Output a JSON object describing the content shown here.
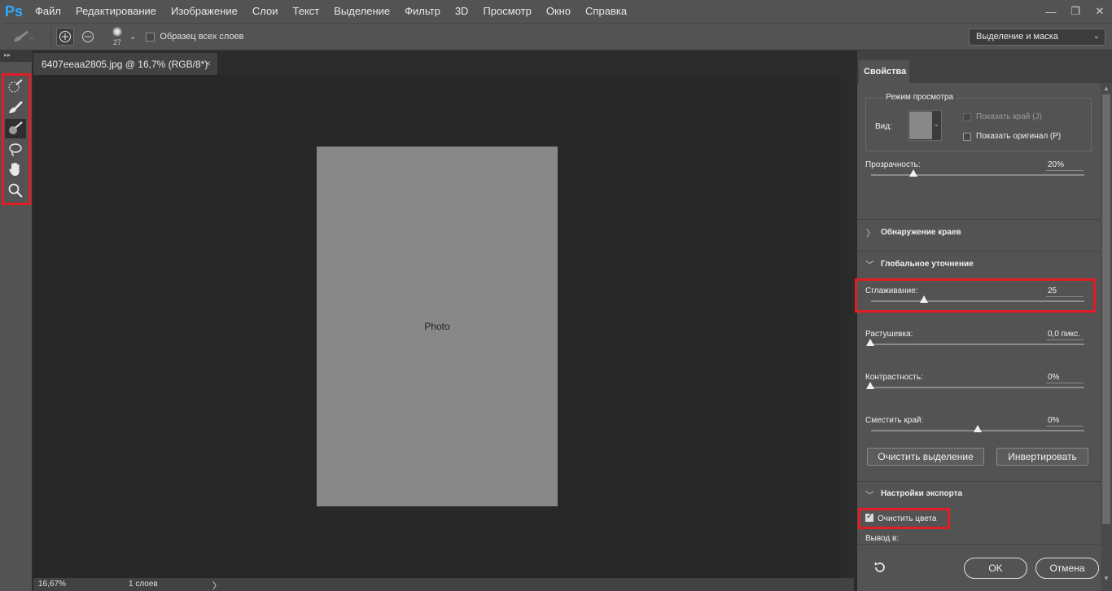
{
  "app": {
    "logo": "Ps"
  },
  "menu": {
    "items": [
      "Файл",
      "Редактирование",
      "Изображение",
      "Слои",
      "Текст",
      "Выделение",
      "Фильтр",
      "3D",
      "Просмотр",
      "Окно",
      "Справка"
    ]
  },
  "window_controls": {
    "minimize": "—",
    "restore": "❐",
    "close": "✕"
  },
  "options": {
    "brush_size": "27",
    "sample_all_layers": "Образец всех слоев",
    "select_and_mask": "Выделение и маска"
  },
  "document": {
    "tab_title": "6407eeaa2805.jpg @ 16,7% (RGB/8*)",
    "close": "×"
  },
  "status": {
    "zoom": "16,67%",
    "layers": "1 слоев",
    "chevron": "〉"
  },
  "properties": {
    "tab": "Свойства",
    "view_mode": {
      "legend": "Режим просмотра",
      "view_label": "Вид:",
      "show_edge": "Показать край (J)",
      "show_original": "Показать оригинал (P)"
    },
    "opacity": {
      "label": "Прозрачность:",
      "value": "20%",
      "level_percent": 20
    },
    "edge_detection": {
      "title": "Обнаружение краев"
    },
    "global_refinements": {
      "title": "Глобальное уточнение",
      "smooth": {
        "label": "Сглаживание:",
        "value": "25",
        "level_fraction": 0.25
      },
      "feather": {
        "label": "Растушевка:",
        "value": "0,0 пикс.",
        "level_fraction": 0
      },
      "contrast": {
        "label": "Контрастность:",
        "value": "0%",
        "level_fraction": 0
      },
      "shift_edge": {
        "label": "Сместить край:",
        "value": "0%",
        "level_fraction": 0.5
      }
    },
    "clear_selection": "Очистить выделение",
    "invert": "Инвертировать",
    "output": {
      "title": "Настройки экспорта",
      "decontaminate": "Очистить цвета",
      "decontaminate_checked": true,
      "output_to": "Вывод в:"
    },
    "ok": "OK",
    "cancel": "Отмена"
  },
  "colors": {
    "accent_ps": "#31a8ff",
    "highlight": "#e21d25",
    "panel": "#535353",
    "canvas": "#282828"
  }
}
